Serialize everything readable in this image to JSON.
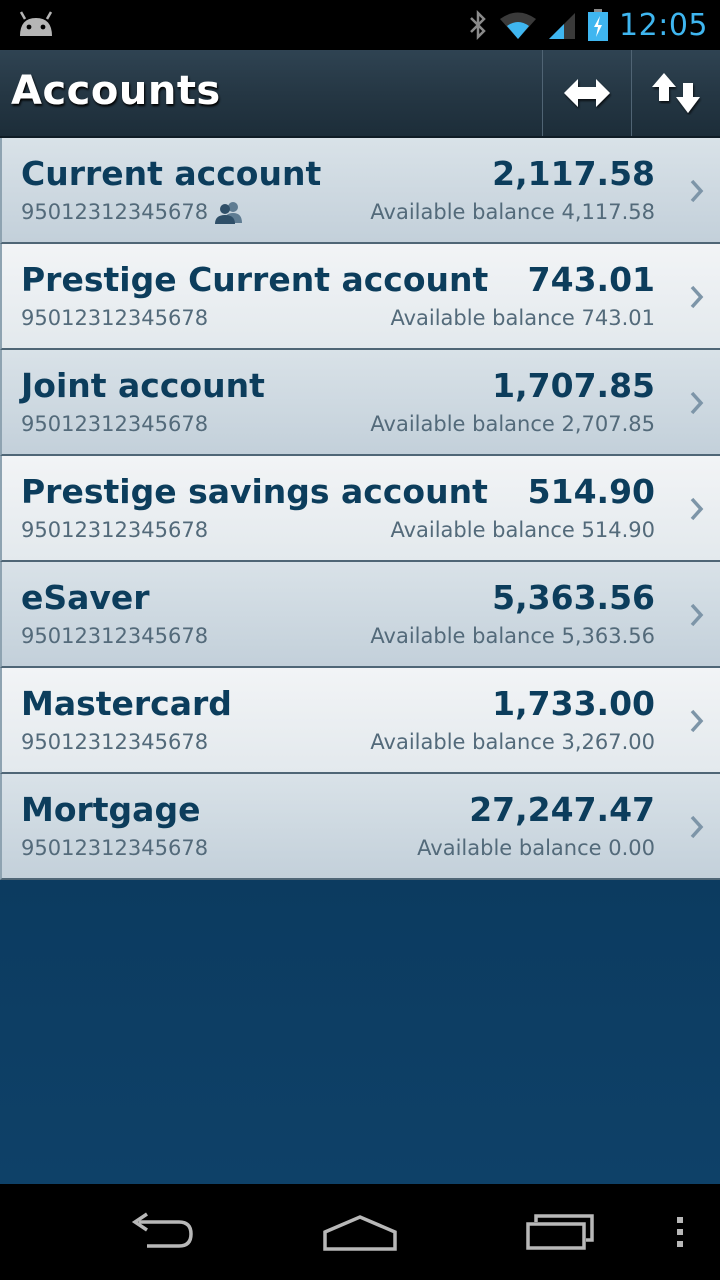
{
  "status_bar": {
    "time": "12:05",
    "icons": [
      "android-icon",
      "bluetooth-icon",
      "wifi-icon",
      "signal-icon",
      "battery-charging-icon"
    ]
  },
  "action_bar": {
    "title": "Accounts",
    "actions": [
      "transfer-arrows-icon",
      "sort-arrows-icon"
    ]
  },
  "accounts": [
    {
      "name": "Current account",
      "amount": "2,117.58",
      "number": "95012312345678",
      "available": "Available balance 4,117.58",
      "joint": true
    },
    {
      "name": "Prestige Current account",
      "amount": "743.01",
      "number": "95012312345678",
      "available": "Available balance 743.01",
      "joint": false
    },
    {
      "name": "Joint account",
      "amount": "1,707.85",
      "number": "95012312345678",
      "available": "Available balance 2,707.85",
      "joint": false
    },
    {
      "name": "Prestige savings account",
      "amount": "514.90",
      "number": "95012312345678",
      "available": "Available balance 514.90",
      "joint": false
    },
    {
      "name": "eSaver",
      "amount": "5,363.56",
      "number": "95012312345678",
      "available": "Available balance 5,363.56",
      "joint": false
    },
    {
      "name": "Mastercard",
      "amount": "1,733.00",
      "number": "95012312345678",
      "available": "Available balance 3,267.00",
      "joint": false
    },
    {
      "name": "Mortgage",
      "amount": "27,247.47",
      "number": "95012312345678",
      "available": "Available balance 0.00",
      "joint": false
    }
  ],
  "nav_bar": [
    "back-icon",
    "home-icon",
    "recent-apps-icon",
    "overflow-menu-icon"
  ],
  "colors": {
    "title_text": "#0c3d5c",
    "secondary_text": "#536a7a",
    "background_blue": "#0c3b60",
    "time": "#3fb6f0"
  }
}
